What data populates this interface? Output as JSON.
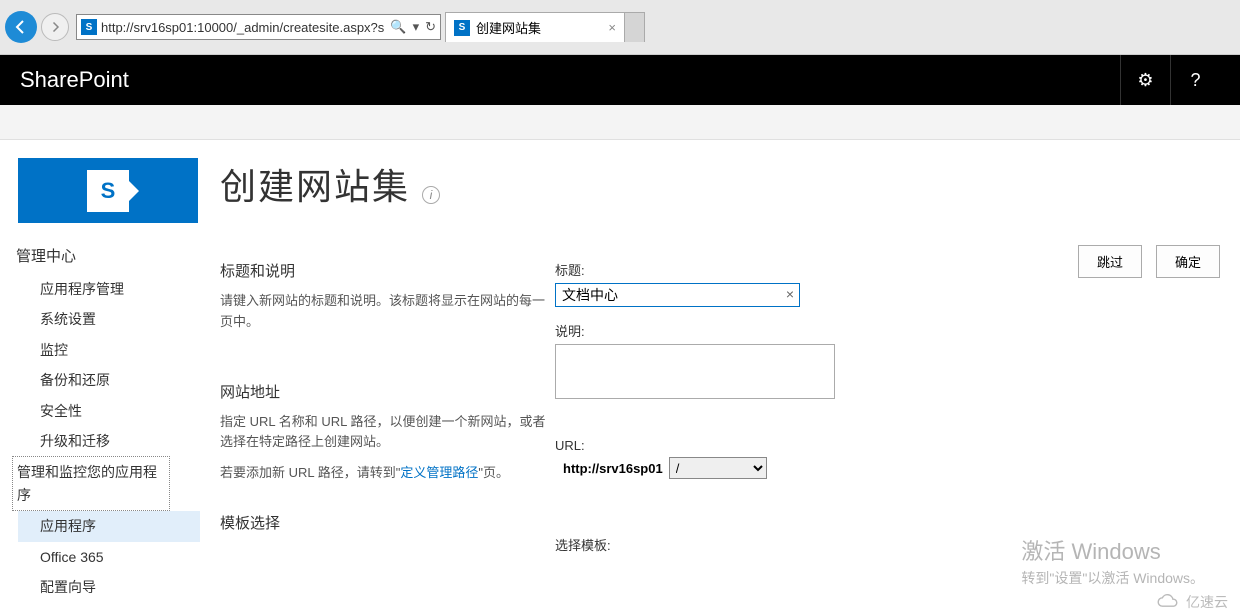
{
  "browser": {
    "url": "http://srv16sp01:10000/_admin/createsite.aspx?s",
    "tab_title": "创建网站集",
    "search_glyph": "🔍"
  },
  "suite": {
    "brand": "SharePoint",
    "gear": "⚙",
    "help": "?"
  },
  "sidebar": {
    "logo_letter": "S",
    "header": "管理中心",
    "items": [
      {
        "label": "应用程序管理"
      },
      {
        "label": "系统设置"
      },
      {
        "label": "监控"
      },
      {
        "label": "备份和还原"
      },
      {
        "label": "安全性"
      },
      {
        "label": "升级和迁移"
      },
      {
        "label": "管理和监控您的应用程序"
      },
      {
        "label": "应用程序"
      },
      {
        "label": "Office 365"
      },
      {
        "label": "配置向导"
      }
    ]
  },
  "page": {
    "title": "创建网站集",
    "info": "i",
    "skip_btn": "跳过",
    "ok_btn": "确定"
  },
  "sections": {
    "title_desc": {
      "header": "标题和说明",
      "body": "请键入新网站的标题和说明。该标题将显示在网站的每一页中。"
    },
    "site_addr": {
      "header": "网站地址",
      "body1": "指定 URL 名称和 URL 路径，以便创建一个新网站，或者选择在特定路径上创建网站。",
      "body2_pre": "若要添加新 URL 路径，请转到\"",
      "body2_link": "定义管理路径",
      "body2_post": "\"页。"
    },
    "template": {
      "header": "模板选择"
    }
  },
  "fields": {
    "title_label": "标题:",
    "title_value": "文档中心",
    "desc_label": "说明:",
    "url_label": "URL:",
    "url_prefix": "http://srv16sp01",
    "url_path": "/",
    "template_label": "选择模板:"
  },
  "watermark": {
    "title": "激活 Windows",
    "sub": "转到\"设置\"以激活 Windows。",
    "cloud": "亿速云"
  }
}
